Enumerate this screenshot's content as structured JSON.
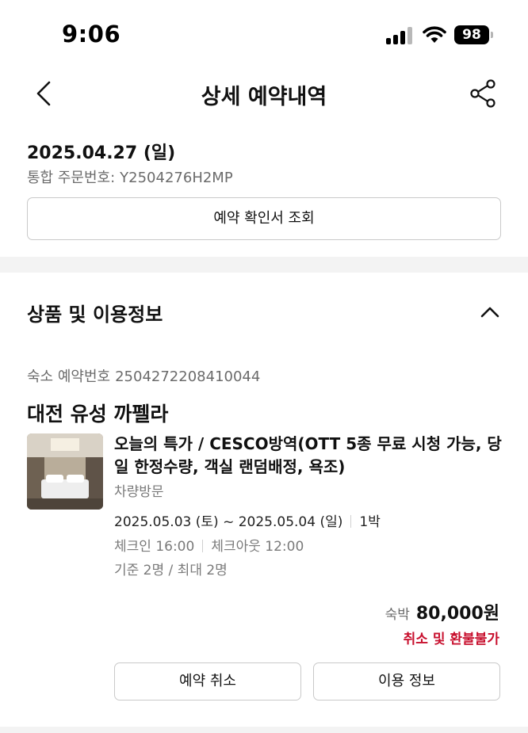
{
  "status_bar": {
    "time": "9:06",
    "battery": "98",
    "icons": [
      "signal-icon",
      "wifi-icon",
      "battery-icon"
    ]
  },
  "header": {
    "title": "상세 예약내역",
    "back_icon": "chevron-left-icon",
    "share_icon": "share-icon"
  },
  "order": {
    "date": "2025.04.27 (일)",
    "number_label": "통합 주문번호:",
    "number": "Y2504276H2MP",
    "confirm_button": "예약 확인서 조회"
  },
  "product_section": {
    "title": "상품 및 이용정보",
    "collapse_icon": "chevron-up-icon",
    "booking_label": "숙소 예약번호",
    "booking_number": "2504272208410044",
    "hotel_name": "대전 유성 까펠라",
    "room_name": "오늘의 특가 / CESCO방역(OTT 5종 무료 시청 가능, 당일 한정수량, 객실 랜덤배정, 욕조)",
    "room_type": "차량방문",
    "check_in_date": "2025.05.03 (토)",
    "date_separator": "~",
    "check_out_date": "2025.05.04 (일)",
    "nights": "1박",
    "check_in_time": "체크인 16:00",
    "check_out_time": "체크아웃 12:00",
    "occupancy": "기준 2명 / 최대 2명",
    "price_label": "숙박",
    "price": "80,000원",
    "refund_policy": "취소 및 환불불가",
    "cancel_button": "예약 취소",
    "info_button": "이용 정보"
  },
  "colors": {
    "accent_red": "#c8102e",
    "border": "#c9c9c9",
    "muted_text": "#6b6b6b"
  }
}
